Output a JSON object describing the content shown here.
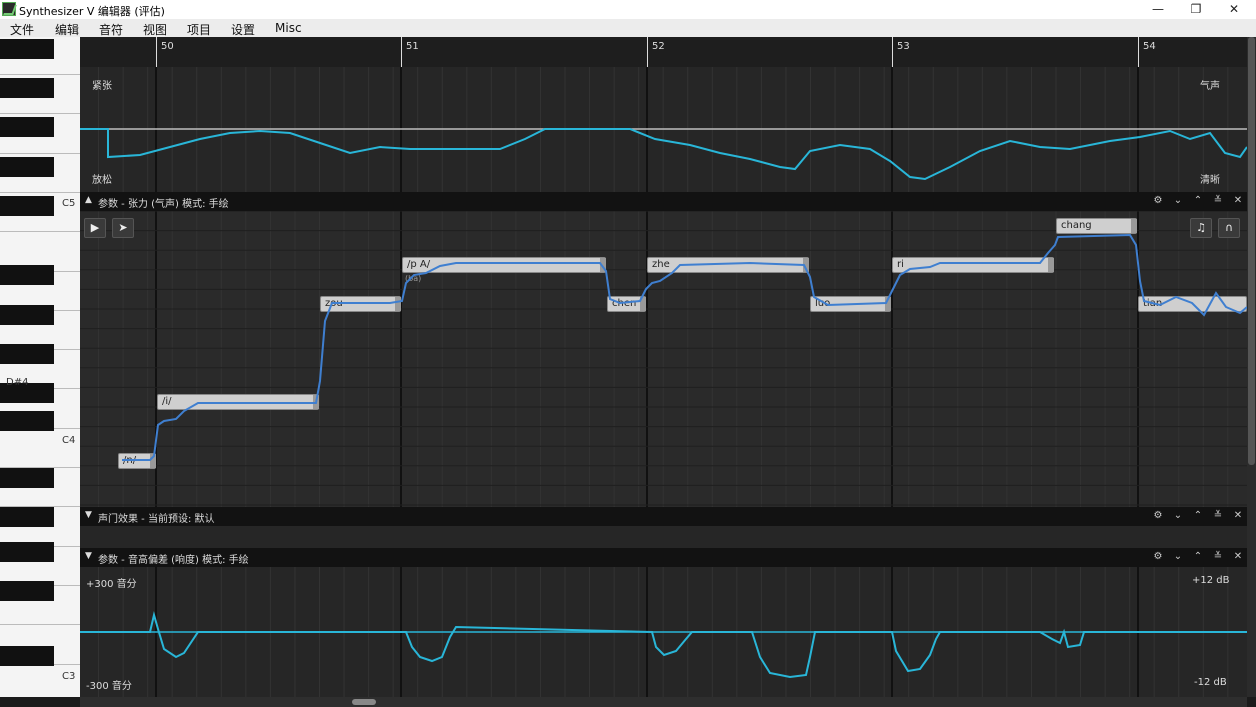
{
  "window": {
    "title": "Synthesizer V 编辑器 (评估)",
    "minimize": "—",
    "maximize": "❐",
    "close": "✕"
  },
  "menu": [
    "文件",
    "编辑",
    "音符",
    "视图",
    "项目",
    "设置",
    "Misc"
  ],
  "piano": {
    "labels": [
      "C5",
      "D#4",
      "C4",
      "C3"
    ]
  },
  "ruler": {
    "bars": [
      "50",
      "51",
      "52",
      "53",
      "54"
    ]
  },
  "tension_panel": {
    "top_left": "紧张",
    "bottom_left": "放松",
    "top_right": "气声",
    "bottom_right": "清晰"
  },
  "header1": {
    "title": "参数 - 张力 (气声) 模式: 手绘"
  },
  "header2": {
    "title": "声门效果 - 当前预设: 默认"
  },
  "header3": {
    "title": "参数 - 音高偏差 (响度) 模式: 手绘"
  },
  "header_icons": [
    "gear-icon",
    "chevron-down-icon",
    "chevron-up-icon",
    "collapse-icon",
    "close-icon"
  ],
  "header_glyphs": [
    "⚙",
    "⌄",
    "⌃",
    "≚",
    "✕"
  ],
  "toolbar": {
    "play": "▶",
    "select": "➤",
    "note_icon": "♫",
    "headphones_icon": "∩"
  },
  "notes": [
    {
      "lyric": "/n/"
    },
    {
      "lyric": "/i/"
    },
    {
      "lyric": "zou"
    },
    {
      "lyric": "/p A/",
      "sub": "(ba)"
    },
    {
      "lyric": "chen"
    },
    {
      "lyric": "zhe"
    },
    {
      "lyric": "luo"
    },
    {
      "lyric": "ri"
    },
    {
      "lyric": "chang"
    },
    {
      "lyric": "tian"
    }
  ],
  "loudness_panel": {
    "top_left": "+300 音分",
    "bottom_left": "-300 音分",
    "top_right": "+12 dB",
    "bottom_right": "-12 dB"
  },
  "colors": {
    "curve": "#29b6d8",
    "pitch": "#3f7fd0",
    "accent_line": "#bdbdbd"
  }
}
